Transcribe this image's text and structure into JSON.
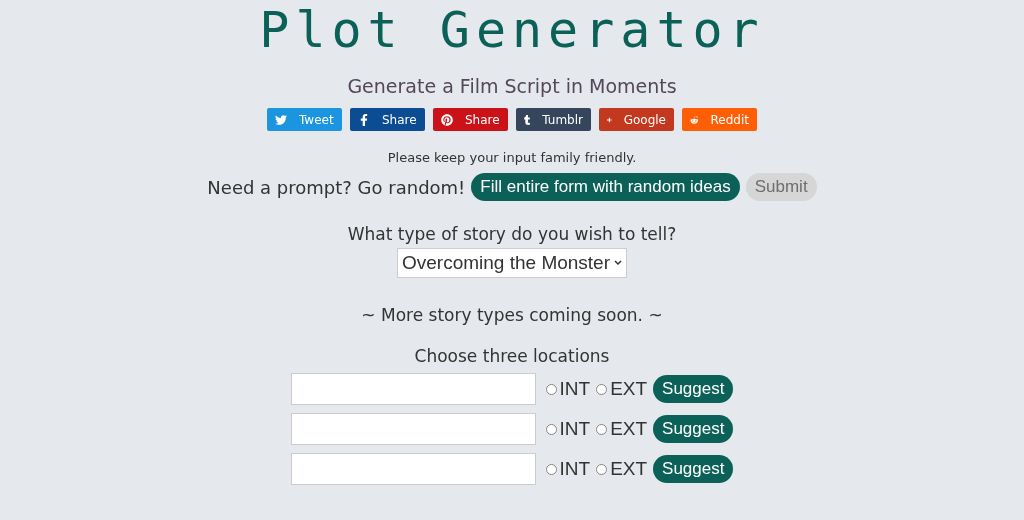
{
  "title": "Plot Generator",
  "subtitle": "Generate a Film Script in Moments",
  "share_buttons": [
    {
      "kind": "twitter",
      "label": "Tweet",
      "color": "#1b95e0"
    },
    {
      "kind": "facebook",
      "label": "Share",
      "color": "#0b4c93"
    },
    {
      "kind": "pinterest",
      "label": "Share",
      "color": "#cb1218"
    },
    {
      "kind": "tumblr",
      "label": "Tumblr",
      "color": "#35465c"
    },
    {
      "kind": "google",
      "label": "Google",
      "color": "#c2391f"
    },
    {
      "kind": "reddit",
      "label": "Reddit",
      "color": "#fe5e05"
    }
  ],
  "notice": "Please keep your input family friendly.",
  "random_prompt": {
    "label": "Need a prompt? Go random!",
    "button": "Fill entire form with random ideas"
  },
  "submit": {
    "label": "Submit",
    "disabled": true
  },
  "story_type": {
    "question": "What type of story do you wish to tell?",
    "value": "Overcoming the Monster"
  },
  "coming_soon": "~ More story types coming soon. ~",
  "locations": {
    "heading": "Choose three locations",
    "rows": [
      {
        "options": [
          {
            "label": "INT",
            "selected": false
          },
          {
            "label": "EXT",
            "selected": false
          }
        ],
        "button": "Suggest"
      },
      {
        "options": [
          {
            "label": "INT",
            "selected": false
          },
          {
            "label": "EXT",
            "selected": false
          }
        ],
        "button": "Suggest"
      },
      {
        "options": [
          {
            "label": "INT",
            "selected": false
          },
          {
            "label": "EXT",
            "selected": false
          }
        ],
        "button": "Suggest"
      }
    ]
  }
}
